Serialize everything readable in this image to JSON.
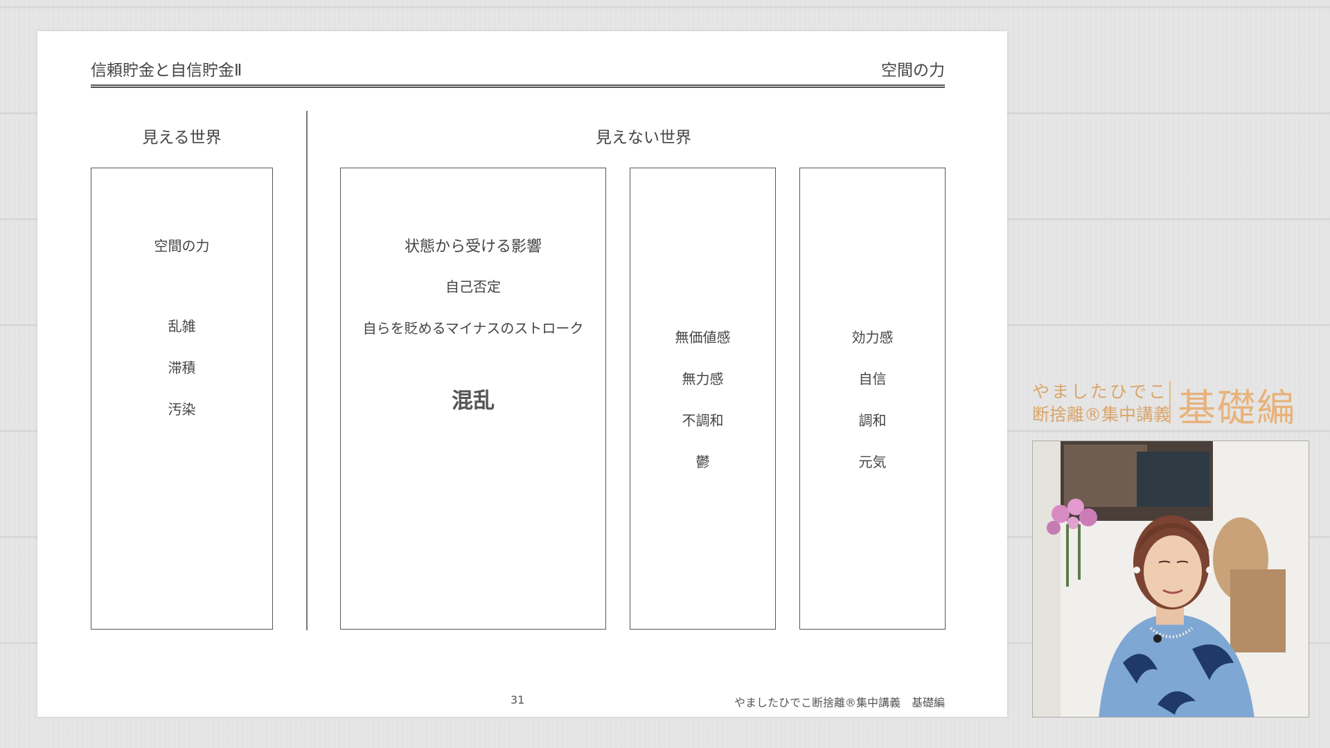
{
  "slide": {
    "header_left": "信頼貯金と自信貯金Ⅱ",
    "header_right": "空間の力",
    "section_left": "見える世界",
    "section_right": "見えない世界",
    "box1": {
      "title": "空間の力",
      "items": [
        "乱雑",
        "滞積",
        "汚染"
      ]
    },
    "box2": {
      "title": "状態から受ける影響",
      "line1": "自己否定",
      "line2": "自らを貶めるマイナスのストローク",
      "big": "混乱"
    },
    "box3": {
      "items": [
        "無価値感",
        "無力感",
        "不調和",
        "鬱"
      ]
    },
    "box4": {
      "items": [
        "効力感",
        "自信",
        "調和",
        "元気"
      ]
    },
    "page_number": "31",
    "footer_brand": "やましたひでこ断捨離®集中講義　基礎編"
  },
  "brand": {
    "line1": "やましたひでこ",
    "line2": "断捨離®集中講義",
    "big": "基礎編"
  },
  "colors": {
    "brand_accent": "#e8b27a"
  }
}
